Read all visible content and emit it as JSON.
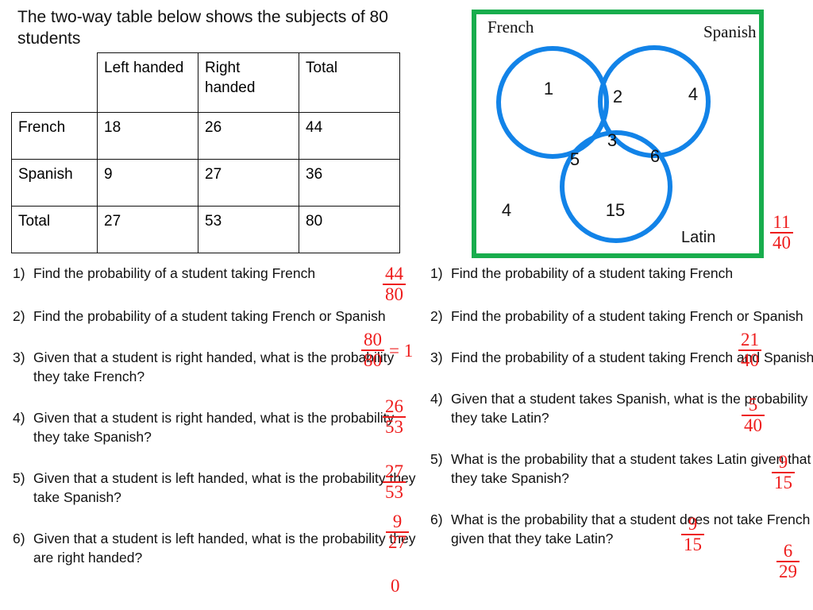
{
  "heading": "The two-way table below shows the subjects of 80 students",
  "colors": {
    "venn_circle": "#1283e8",
    "venn_border": "#18ad4d",
    "answer_red": "#ee1c1c",
    "text": "#111111"
  },
  "table": {
    "corner": "",
    "column_headers": [
      "Left handed",
      "Right handed",
      "Total"
    ],
    "rows": [
      {
        "label": "French",
        "cells": [
          "18",
          "26",
          "44"
        ]
      },
      {
        "label": "Spanish",
        "cells": [
          "9",
          "27",
          "36"
        ]
      },
      {
        "label": "Total",
        "cells": [
          "27",
          "53",
          "80"
        ]
      }
    ]
  },
  "venn": {
    "set_labels": {
      "french": "French",
      "spanish": "Spanish",
      "latin": "Latin"
    },
    "regions": {
      "french_only": "1",
      "french_spanish": "2",
      "spanish_only": "4",
      "all_three": "3",
      "french_latin": "5",
      "spanish_latin": "6",
      "latin_only": "15",
      "outside": "4"
    },
    "outside_answer": {
      "num": "11",
      "den": "40"
    }
  },
  "questions_left": [
    {
      "num": "1)",
      "text": "Find the probability of a student taking French",
      "answer": {
        "num": "44",
        "den": "80",
        "suffix": ""
      }
    },
    {
      "num": "2)",
      "text": "Find the probability of a student taking French or Spanish",
      "answer": {
        "num": "80",
        "den": "80",
        "suffix": "= 1"
      }
    },
    {
      "num": "3)",
      "text": "Given that a student is right handed, what is the probability they take French?",
      "answer": {
        "num": "26",
        "den": "53",
        "suffix": ""
      }
    },
    {
      "num": "4)",
      "text": "Given that a student is right handed, what is the probability they take Spanish?",
      "answer": {
        "num": "27",
        "den": "53",
        "suffix": ""
      }
    },
    {
      "num": "5)",
      "text": "Given that a student is left handed, what is the probability they take Spanish?",
      "answer": {
        "num": "9",
        "den": "27",
        "suffix": ""
      }
    },
    {
      "num": "6)",
      "text": "Given that a student is left handed, what is the probability they are right handed?",
      "answer": {
        "whole": "0"
      }
    }
  ],
  "questions_right": [
    {
      "num": "1)",
      "text": "Find the probability of a student taking French",
      "answer": null
    },
    {
      "num": "2)",
      "text": "Find the probability of a student taking French or Spanish",
      "answer": {
        "num": "21",
        "den": "40",
        "suffix": ""
      }
    },
    {
      "num": "3)",
      "text": "Find the probability of a student taking French and Spanish",
      "answer": {
        "num": "5",
        "den": "40",
        "suffix": ""
      }
    },
    {
      "num": "4)",
      "text": "Given that a student takes Spanish, what is the probability they take Latin?",
      "answer": {
        "num": "9",
        "den": "15",
        "suffix": ""
      }
    },
    {
      "num": "5)",
      "text": "What is the probability that a student takes Latin given that they take Spanish?",
      "answer": {
        "num": "9",
        "den": "15",
        "suffix": ""
      }
    },
    {
      "num": "6)",
      "text": "What is the probability that a student does not take French given that they take Latin?",
      "answer": {
        "num": "6",
        "den": "29",
        "suffix": ""
      }
    }
  ]
}
